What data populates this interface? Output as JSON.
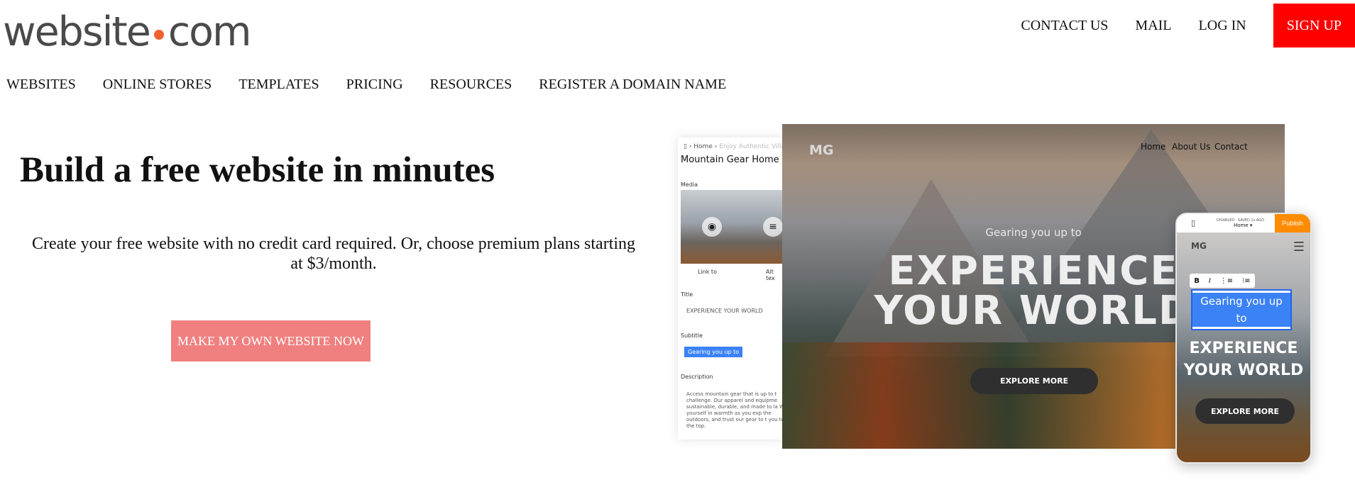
{
  "header": {
    "logo_left": "website",
    "logo_right": "com",
    "top_links": [
      "CONTACT US",
      "MAIL",
      "LOG IN"
    ],
    "signup": "SIGN UP"
  },
  "main_nav": [
    "WEBSITES",
    "ONLINE STORES",
    "TEMPLATES",
    "PRICING",
    "RESOURCES",
    "REGISTER A DOMAIN NAME"
  ],
  "hero": {
    "title": "Build a free website in minutes",
    "subtitle": "Create your free website with no credit card required. Or, choose premium plans starting at $3/month.",
    "cta": "MAKE MY OWN WEBSITE NOW"
  },
  "editor": {
    "breadcrumb_home": "Home",
    "breadcrumb_faded": "Enjoy Authentic Village Li",
    "page_title": "Mountain Gear Home",
    "media_label": "Media",
    "link_to": "Link to",
    "alt_text": "Alt tex",
    "title_label": "Title",
    "title_value": "EXPERIENCE YOUR WORLD",
    "subtitle_label": "Subtitle",
    "subtitle_value": "Gearing you up to",
    "description_label": "Description",
    "description_value": "Access mountain gear that is up to t challenge. Our apparel and equipme sustainable, durable, and made to la Wrap yourself in warmth as you exp the outdoors, and trust our gear to t you to the top."
  },
  "desktop_preview": {
    "logo": "MG",
    "nav": [
      "Home",
      "About Us",
      "Contact"
    ],
    "kicker": "Gearing you up to",
    "headline_line1": "EXPERIENCE",
    "headline_line2": "YOUR WORLD",
    "button": "EXPLORE MORE"
  },
  "mobile_preview": {
    "top_tiny": "DISABLED · SAVED 1s AGO",
    "page_select": "Home",
    "publish": "Publish",
    "logo": "MG",
    "editing_text": "Gearing you up to",
    "headline_line1": "EXPERIENCE",
    "headline_line2": "YOUR WORLD",
    "button": "EXPLORE MORE"
  },
  "colors": {
    "signup_bg": "#ff0000",
    "cta_bg": "#f08080",
    "logo_dot": "#f0612e",
    "publish_bg": "#ff8c00",
    "selection": "#3b82f6"
  }
}
